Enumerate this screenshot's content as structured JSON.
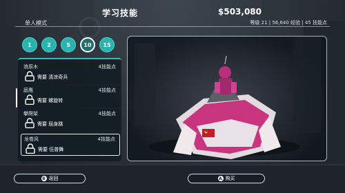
{
  "header": {
    "title": "学习技能",
    "money": "$503,080",
    "mode": "单人模式",
    "stats": "等级 21 | 56,640 经验 | 45 技能点"
  },
  "tabs": [
    {
      "label": "1",
      "active": false
    },
    {
      "label": "2",
      "active": false
    },
    {
      "label": "5",
      "active": false
    },
    {
      "label": "10",
      "active": true
    },
    {
      "label": "15",
      "active": false
    }
  ],
  "skills": [
    {
      "name": "浪原木",
      "points": "4技能点",
      "requirement": "需要 清凉奇兵",
      "selected": false
    },
    {
      "name": "庭鹰",
      "points": "4技能点",
      "requirement": "需要 螺旋转",
      "selected": false
    },
    {
      "name": "攀爬架",
      "points": "4技能点",
      "requirement": "需要 屈身跳",
      "selected": false
    },
    {
      "name": "龙卷风",
      "points": "4技能点",
      "requirement": "需要 伍普舞",
      "selected": true
    }
  ],
  "buttons": {
    "back": {
      "key": "B",
      "label": "返回"
    },
    "buy": {
      "key": "A",
      "label": "购买"
    }
  },
  "colors": {
    "accent": "#27b3b0",
    "accent_light": "#58d0cc",
    "vehicle_pink": "#d63c8c",
    "vehicle_white": "#e8e2e6"
  }
}
